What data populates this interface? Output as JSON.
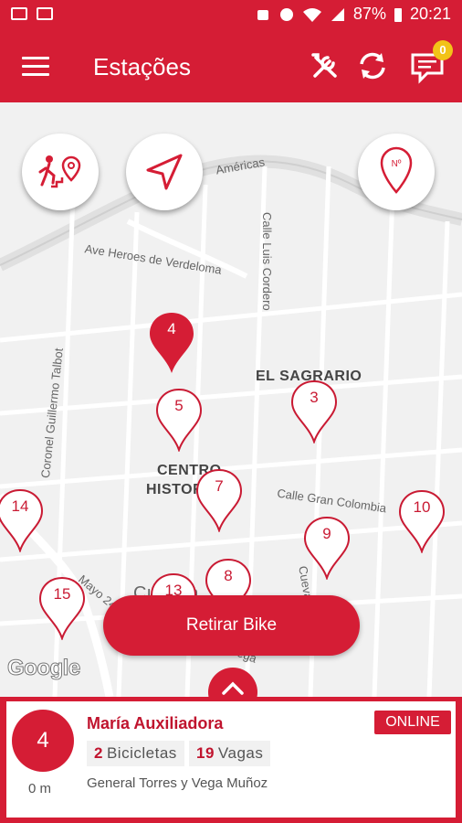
{
  "status_bar": {
    "battery": "87%",
    "time": "20:21"
  },
  "app_bar": {
    "title": "Estações",
    "notifications_count": "0"
  },
  "map": {
    "streets": {
      "americas": "Américas",
      "luis_cordero": "Calle Luis Cordero",
      "heroes": "Ave Heroes de Verdeloma",
      "guillermo": "Coronel Guillermo Talbot",
      "gran_colombia": "Calle Gran Colombia",
      "mayo": "Mayo 24",
      "cueva": "Cueva",
      "vega": "Vega"
    },
    "districts": {
      "sagrario": "EL SAGRARIO",
      "centro1": "CENTRO",
      "centro2": "HISTORICO",
      "cuenca": "Cuenca"
    },
    "pins": [
      "4",
      "5",
      "3",
      "7",
      "14",
      "10",
      "9",
      "8",
      "15",
      "13"
    ],
    "retirar_label": "Retirar Bike",
    "attribution": "Google"
  },
  "station_card": {
    "id": "4",
    "distance": "0 m",
    "name": "María Auxiliadora",
    "status": "ONLINE",
    "bikes_count": "2",
    "bikes_label": "Bicicletas",
    "slots_count": "19",
    "slots_label": "Vagas",
    "address": "General Torres y Vega Muñoz"
  },
  "colors": {
    "brand": "#d51d35",
    "badge": "#f2c318"
  },
  "icons": {
    "menu": "hamburger-icon",
    "tools": "tools-icon",
    "refresh": "refresh-icon",
    "messages": "message-icon",
    "walk": "walk-to-pin-icon",
    "locate": "navigation-arrow-icon",
    "station_number": "station-number-pin-icon"
  }
}
